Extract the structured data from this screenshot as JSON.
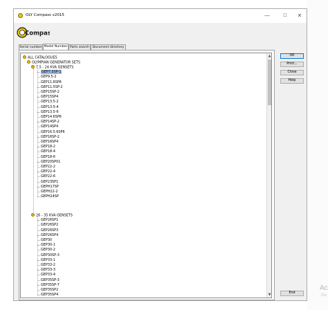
{
  "window": {
    "title": "OLY Compass v2015",
    "controls": {
      "minimize": "—",
      "maximize": "☐",
      "close": "✕"
    }
  },
  "logo": {
    "text": "Compass"
  },
  "tabs": [
    {
      "label": "Serial number",
      "active": false
    },
    {
      "label": "Model Number",
      "active": true
    },
    {
      "label": "Parts search",
      "active": false
    },
    {
      "label": "Document directory",
      "active": false
    }
  ],
  "tree": {
    "root": "ALL CATALOGUES",
    "group": "OLYMPIAN GENERATOR SETS",
    "sections": [
      {
        "label": "7.5 - 24 KVA GENSETS",
        "selected_index": 0,
        "items": [
          "GEP7.5SP-1",
          "GEP9.5-2",
          "GEP11.6SP6",
          "GEP11.5SP-2",
          "GEP15SP-2",
          "GEP15SP4",
          "GEP13.5-2",
          "GEP13.5-4",
          "GEP13.5-6",
          "GEP14.6SP6",
          "GEP14SP-2",
          "GEP14SP4",
          "GEP16.5.6SP6",
          "GEP16SP-2",
          "GEP16SP4",
          "GEP18-2",
          "GEP18-4",
          "GEP18-6",
          "GEP20SP01",
          "GEP22-2",
          "GEP22-4",
          "GEP22-6",
          "GEP23SP1",
          "GEPH17SP",
          "GEPH22-2",
          "GEPH24SP"
        ]
      },
      {
        "label": "26 - 35 KVA GENSETS",
        "items": [
          "GEP26SP1",
          "GEP26SP2",
          "GEP26SP3",
          "GEP26SP4",
          "GEP30",
          "GEP30-1",
          "GEP30-2",
          "GEP30SP-3",
          "GEP33-1",
          "GEP33-2",
          "GEP33-3",
          "GEP33-4",
          "GEP35SP-3",
          "GEP35SP-7",
          "GEP35SP2",
          "GEP35SP4"
        ]
      }
    ],
    "scroll": {
      "up": "▲",
      "down": "▼",
      "position": 0.0
    }
  },
  "buttons": {
    "ok": "OK",
    "print": "Print...",
    "close": "Close",
    "help": "Help",
    "end": "End"
  },
  "watermark": {
    "line1": "Ac",
    "line2": "Go"
  }
}
